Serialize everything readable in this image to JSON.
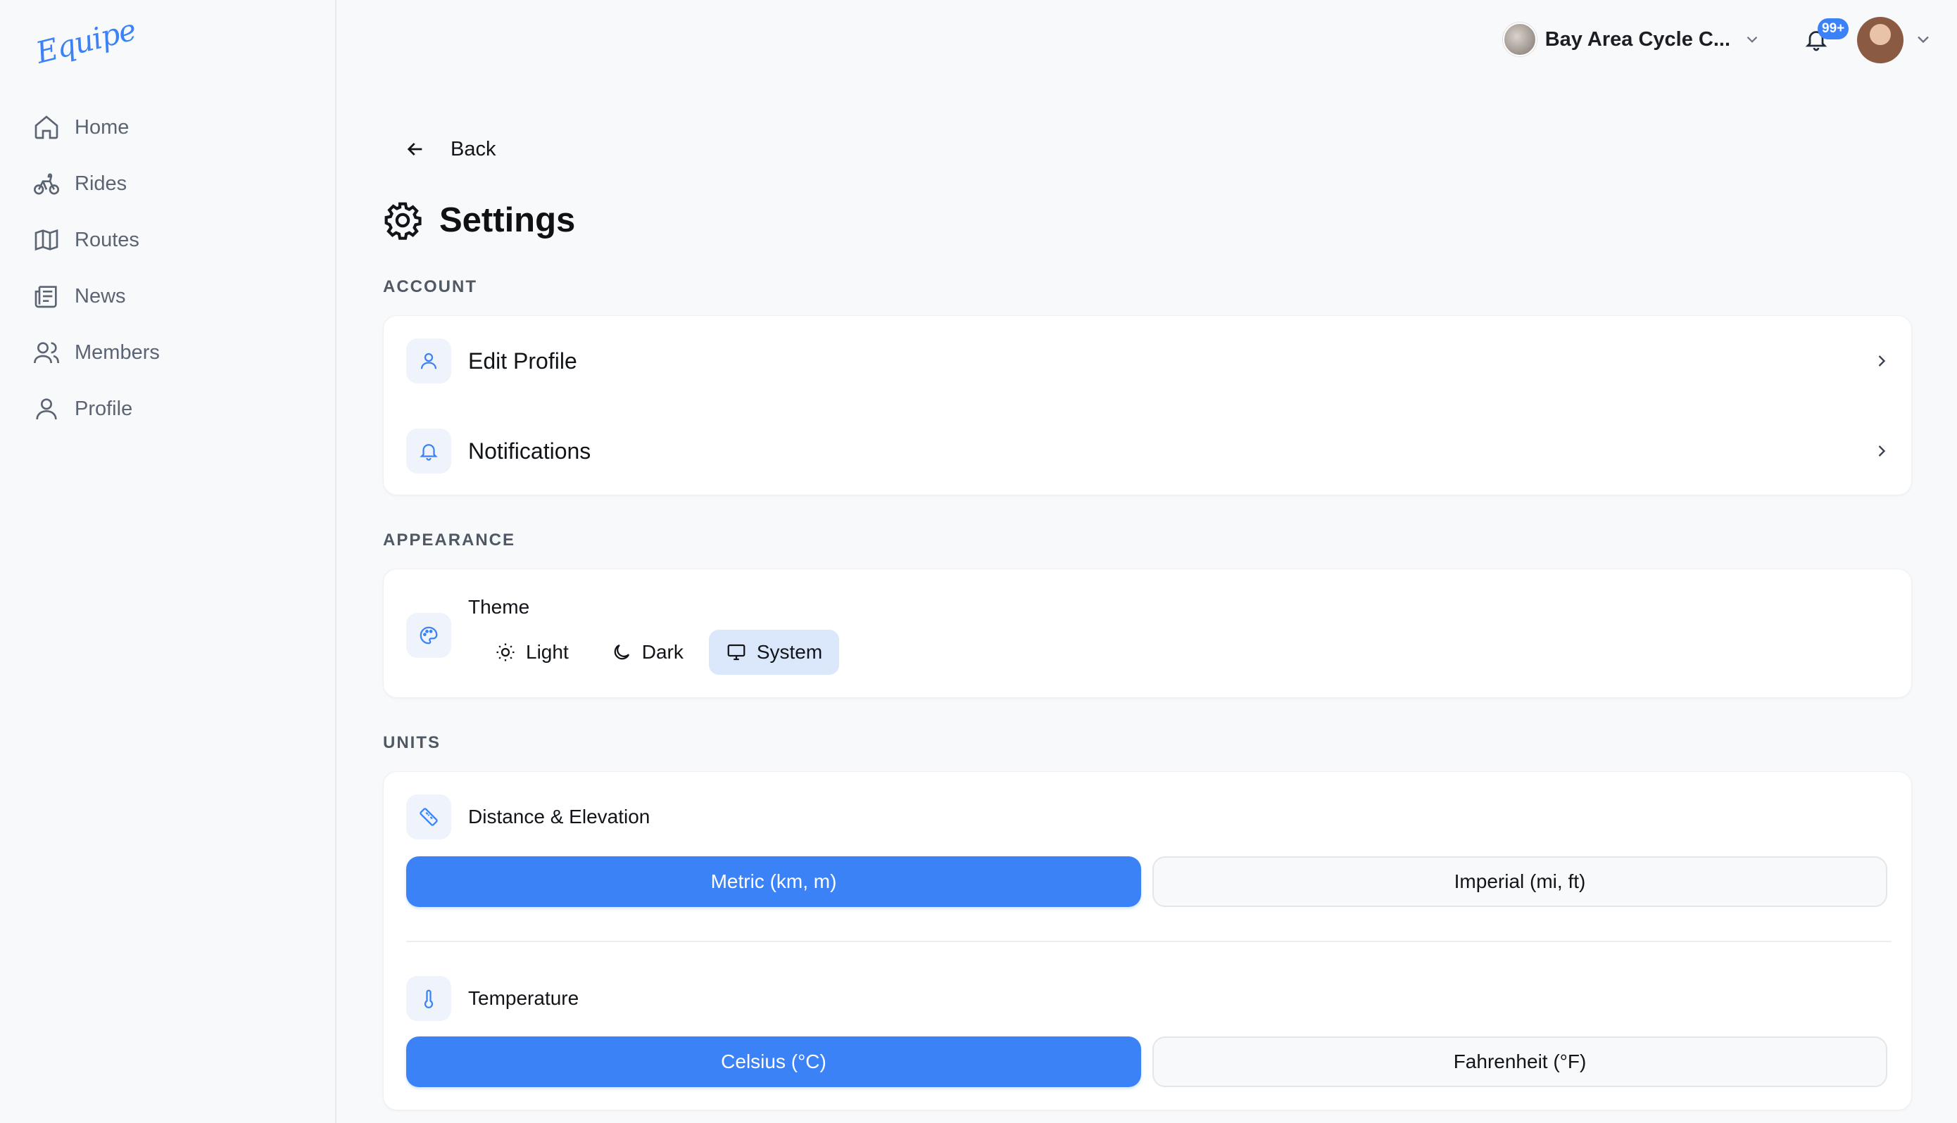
{
  "app": {
    "logo": "Equipe"
  },
  "sidebar": {
    "items": [
      {
        "label": "Home",
        "icon": "home-icon"
      },
      {
        "label": "Rides",
        "icon": "bike-icon"
      },
      {
        "label": "Routes",
        "icon": "map-icon"
      },
      {
        "label": "News",
        "icon": "newspaper-icon"
      },
      {
        "label": "Members",
        "icon": "users-icon"
      },
      {
        "label": "Profile",
        "icon": "user-icon"
      }
    ]
  },
  "topbar": {
    "org_name": "Bay Area Cycle C...",
    "notifications_badge": "99+"
  },
  "page": {
    "back_label": "Back",
    "title": "Settings"
  },
  "account": {
    "section_label": "ACCOUNT",
    "edit_profile": "Edit Profile",
    "notifications": "Notifications"
  },
  "appearance": {
    "section_label": "APPEARANCE",
    "theme_label": "Theme",
    "options": [
      "Light",
      "Dark",
      "System"
    ],
    "selected": "System"
  },
  "units": {
    "section_label": "UNITS",
    "distance_label": "Distance & Elevation",
    "distance_options": [
      "Metric (km, m)",
      "Imperial (mi, ft)"
    ],
    "distance_selected": "Metric (km, m)",
    "temperature_label": "Temperature",
    "temperature_options": [
      "Celsius (°C)",
      "Fahrenheit (°F)"
    ],
    "temperature_selected": "Celsius (°C)"
  },
  "colors": {
    "accent": "#3b82f6",
    "accent_soft": "#dbe8fb"
  }
}
